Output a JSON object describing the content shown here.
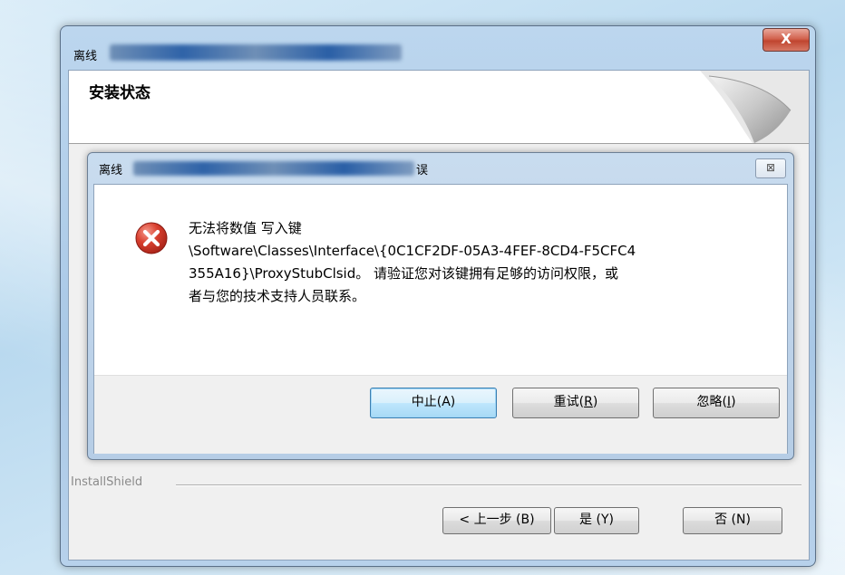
{
  "outer_window": {
    "title_prefix": "离线",
    "close_label": "X",
    "header_title": "安装状态",
    "installshield_label": "InstallShield",
    "buttons": {
      "back": "< 上一步 (B)",
      "yes": "是 (Y)",
      "no": "否 (N)"
    }
  },
  "error_dialog": {
    "title_prefix": "离线",
    "title_suffix": "误",
    "close_label": "⊠",
    "icon": "error-icon",
    "message_lines": [
      "无法将数值 写入键",
      "\\Software\\Classes\\Interface\\{0C1CF2DF-05A3-4FEF-8CD4-F5CFC4",
      "355A16}\\ProxyStubClsid。 请验证您对该键拥有足够的访问权限，或",
      "者与您的技术支持人员联系。"
    ],
    "buttons": {
      "abort_text": "中止(A)",
      "retry_text": "重试(",
      "retry_key": "R",
      "retry_end": ")",
      "ignore_text": "忽略(",
      "ignore_key": "I",
      "ignore_end": ")"
    }
  },
  "colors": {
    "error_red": "#d43a2f",
    "default_button_border": "#3c7fb1"
  }
}
